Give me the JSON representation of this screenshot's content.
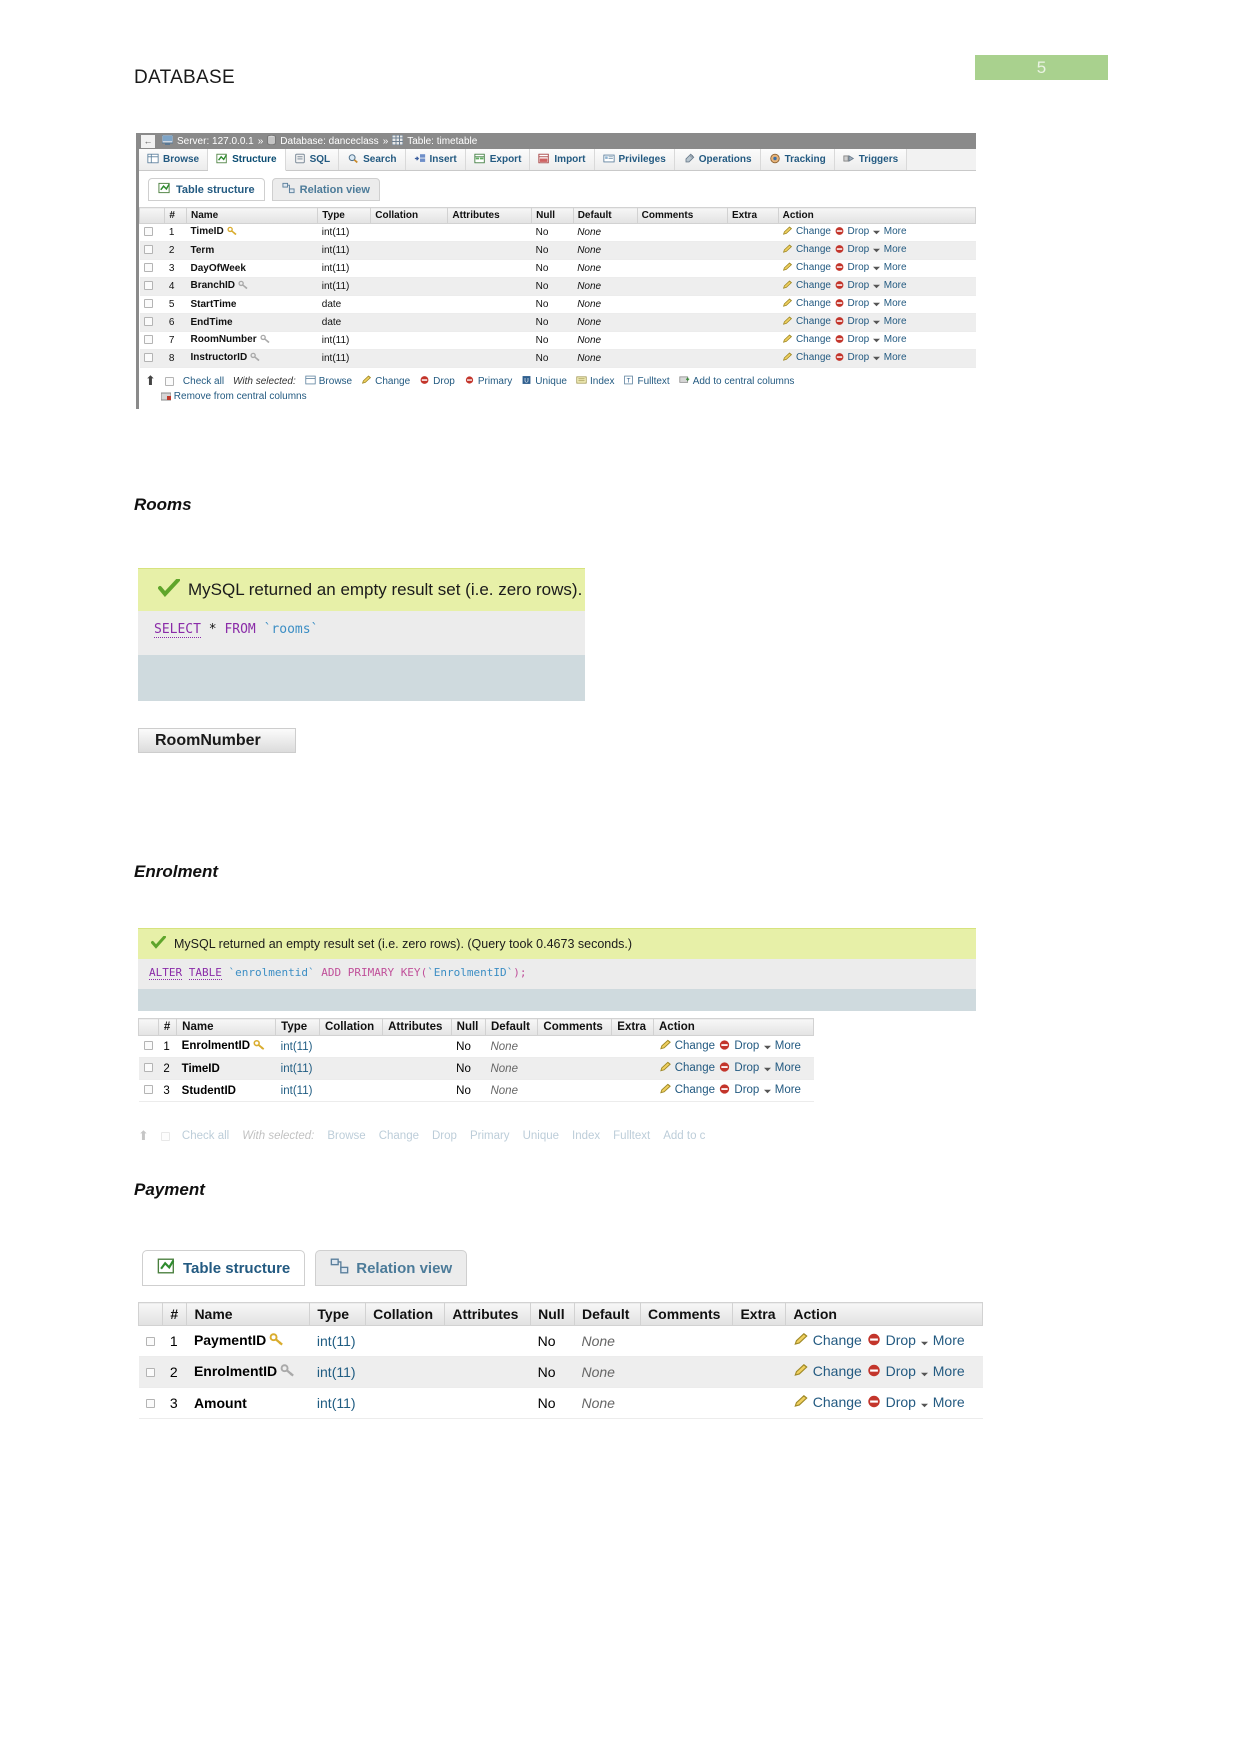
{
  "document": {
    "title": "DATABASE",
    "page_number": "5",
    "page_badge_color": "#a9d18e"
  },
  "sections": [
    {
      "heading": "Rooms"
    },
    {
      "heading": "Enrolment"
    },
    {
      "heading": "Payment"
    }
  ],
  "timetable_panel": {
    "breadcrumb": {
      "back_arrow": "←",
      "server_icon": "server-icon",
      "server": "Server: 127.0.0.1",
      "sep1": "»",
      "database_icon": "database-icon",
      "database": "Database: danceclass",
      "sep2": "»",
      "table_icon": "table-icon",
      "table": "Table: timetable"
    },
    "tabs": [
      {
        "label": "Browse",
        "icon": "browse-icon",
        "active": false
      },
      {
        "label": "Structure",
        "icon": "structure-icon",
        "active": true
      },
      {
        "label": "SQL",
        "icon": "sql-icon",
        "active": false
      },
      {
        "label": "Search",
        "icon": "search-icon",
        "active": false
      },
      {
        "label": "Insert",
        "icon": "insert-icon",
        "active": false
      },
      {
        "label": "Export",
        "icon": "export-icon",
        "active": false
      },
      {
        "label": "Import",
        "icon": "import-icon",
        "active": false
      },
      {
        "label": "Privileges",
        "icon": "privileges-icon",
        "active": false
      },
      {
        "label": "Operations",
        "icon": "operations-icon",
        "active": false
      },
      {
        "label": "Tracking",
        "icon": "tracking-icon",
        "active": false
      },
      {
        "label": "Triggers",
        "icon": "triggers-icon",
        "active": false
      }
    ],
    "subtabs": [
      {
        "label": "Table structure",
        "icon": "table-structure-icon",
        "active": true
      },
      {
        "label": "Relation view",
        "icon": "relation-view-icon",
        "active": false
      }
    ],
    "columns": [
      "#",
      "Name",
      "Type",
      "Collation",
      "Attributes",
      "Null",
      "Default",
      "Comments",
      "Extra",
      "Action"
    ],
    "rows": [
      {
        "num": "1",
        "name": "TimeID",
        "key": "primary",
        "type": "int(11)",
        "collation": "",
        "attributes": "",
        "null": "No",
        "default": "None",
        "comments": "",
        "extra": ""
      },
      {
        "num": "2",
        "name": "Term",
        "key": "none",
        "type": "int(11)",
        "collation": "",
        "attributes": "",
        "null": "No",
        "default": "None",
        "comments": "",
        "extra": ""
      },
      {
        "num": "3",
        "name": "DayOfWeek",
        "key": "none",
        "type": "int(11)",
        "collation": "",
        "attributes": "",
        "null": "No",
        "default": "None",
        "comments": "",
        "extra": ""
      },
      {
        "num": "4",
        "name": "BranchID",
        "key": "index",
        "type": "int(11)",
        "collation": "",
        "attributes": "",
        "null": "No",
        "default": "None",
        "comments": "",
        "extra": ""
      },
      {
        "num": "5",
        "name": "StartTime",
        "key": "none",
        "type": "date",
        "collation": "",
        "attributes": "",
        "null": "No",
        "default": "None",
        "comments": "",
        "extra": ""
      },
      {
        "num": "6",
        "name": "EndTime",
        "key": "none",
        "type": "date",
        "collation": "",
        "attributes": "",
        "null": "No",
        "default": "None",
        "comments": "",
        "extra": ""
      },
      {
        "num": "7",
        "name": "RoomNumber",
        "key": "index",
        "type": "int(11)",
        "collation": "",
        "attributes": "",
        "null": "No",
        "default": "None",
        "comments": "",
        "extra": ""
      },
      {
        "num": "8",
        "name": "InstructorID",
        "key": "index",
        "type": "int(11)",
        "collation": "",
        "attributes": "",
        "null": "No",
        "default": "None",
        "comments": "",
        "extra": ""
      }
    ],
    "row_actions": {
      "change": "Change",
      "drop": "Drop",
      "more": "More"
    },
    "footer": {
      "check_all": "Check all",
      "with_selected": "With selected:",
      "actions": [
        "Browse",
        "Change",
        "Drop",
        "Primary",
        "Unique",
        "Index",
        "Fulltext",
        "Add to central columns"
      ],
      "remove_central": "Remove from central columns"
    }
  },
  "rooms_result": {
    "message": "MySQL returned an empty result set (i.e. zero rows).",
    "check_icon": "check-icon",
    "query": {
      "kw1": "SELECT",
      "star": "*",
      "kw2": "FROM",
      "ident": "`rooms`"
    },
    "result_header": "RoomNumber"
  },
  "enrolment_result": {
    "message": "MySQL returned an empty result set (i.e. zero rows). (Query took 0.4673 seconds.)",
    "check_icon": "check-icon",
    "query": {
      "kw1": "ALTER",
      "kw2": "TABLE",
      "ident1": "`enrolmentid`",
      "kw3": "ADD PRIMARY KEY",
      "paren_open": "(",
      "ident2": "`EnrolmentID`",
      "paren_close": ");"
    },
    "columns": [
      "#",
      "Name",
      "Type",
      "Collation",
      "Attributes",
      "Null",
      "Default",
      "Comments",
      "Extra",
      "Action"
    ],
    "rows": [
      {
        "num": "1",
        "name": "EnrolmentID",
        "key": "primary",
        "type": "int(11)",
        "null": "No",
        "default": "None"
      },
      {
        "num": "2",
        "name": "TimeID",
        "key": "none",
        "type": "int(11)",
        "null": "No",
        "default": "None"
      },
      {
        "num": "3",
        "name": "StudentID",
        "key": "none",
        "type": "int(11)",
        "null": "No",
        "default": "None"
      }
    ],
    "row_actions": {
      "change": "Change",
      "drop": "Drop",
      "more": "More"
    },
    "footer_faded": [
      "Check all",
      "With selected:",
      "Browse",
      "Change",
      "Drop",
      "Primary",
      "Unique",
      "Index",
      "Fulltext",
      "Add to c"
    ]
  },
  "payment_panel": {
    "subtabs": [
      {
        "label": "Table structure",
        "icon": "table-structure-icon",
        "active": true
      },
      {
        "label": "Relation view",
        "icon": "relation-view-icon",
        "active": false
      }
    ],
    "columns": [
      "#",
      "Name",
      "Type",
      "Collation",
      "Attributes",
      "Null",
      "Default",
      "Comments",
      "Extra",
      "Action"
    ],
    "rows": [
      {
        "num": "1",
        "name": "PaymentID",
        "key": "primary",
        "type": "int(11)",
        "null": "No",
        "default": "None"
      },
      {
        "num": "2",
        "name": "EnrolmentID",
        "key": "index",
        "type": "int(11)",
        "null": "No",
        "default": "None"
      },
      {
        "num": "3",
        "name": "Amount",
        "key": "none",
        "type": "int(11)",
        "null": "No",
        "default": "None"
      }
    ],
    "row_actions": {
      "change": "Change",
      "drop": "Drop",
      "more": "More"
    }
  },
  "colors": {
    "link": "#235a81",
    "success_bg": "#e7f0a8",
    "query_bg": "#ececec",
    "drop_red": "#c3352b",
    "key_gold": "#e8c24a"
  }
}
